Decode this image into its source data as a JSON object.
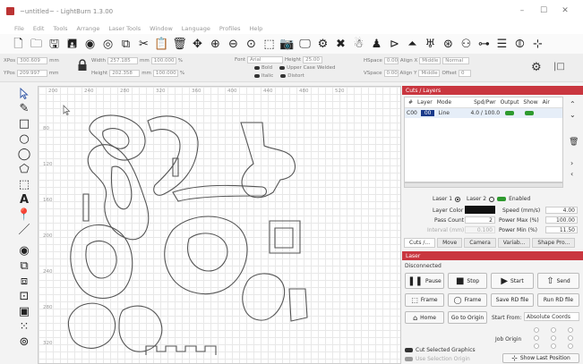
{
  "window": {
    "title": "~untitled~ - LightBurn 1.3.00",
    "min": "–",
    "max": "☐",
    "close": "✕"
  },
  "menu": [
    "File",
    "Edit",
    "Tools",
    "Arrange",
    "Laser Tools",
    "Window",
    "Language",
    "Profiles",
    "Help"
  ],
  "toolbar_icons": [
    "new-file",
    "open",
    "save",
    "save-as",
    "import",
    "export",
    "copy",
    "cut",
    "paste",
    "delete",
    "move",
    "zoom-in",
    "zoom-out",
    "zoom-frame",
    "zoom-selection",
    "camera",
    "monitor",
    "settings",
    "tools",
    "users",
    "user",
    "arrange-1",
    "arrange-2",
    "arrange-3",
    "target",
    "group",
    "ungroup",
    "align",
    "distribute",
    "center"
  ],
  "numbar": {
    "xpos_label": "XPos",
    "xpos": "300.609",
    "ypos_label": "YPos",
    "ypos": "209.997",
    "unit": "mm",
    "width_label": "Width",
    "width": "257.185",
    "height_label": "Height",
    "height": "202.358",
    "wpct": "100.000",
    "hpct": "100.000",
    "pct": "%",
    "font_label": "Font",
    "font": "Arial",
    "fheight_label": "Height",
    "fheight": "25.00",
    "bold": "Bold",
    "italic": "Italic",
    "upper": "Upper Case",
    "distort": "Distort",
    "welded": "Welded",
    "hspace_label": "HSpace",
    "hspace": "0.00",
    "vspace_label": "VSpace",
    "vspace": "0.00",
    "alignx": "Align X",
    "aligny": "Align Y",
    "middle": "Middle",
    "normal": "Normal",
    "offset_label": "Offset",
    "offset": "0"
  },
  "left_tools": [
    "select-arrow",
    "edit-nodes",
    "rectangle",
    "ellipse",
    "ellipse-2",
    "polygon",
    "frame-tool",
    "text-tool",
    "position-pin",
    "measure-tool",
    "offset-tool",
    "boolean-union",
    "boolean-subtract",
    "boolean-intersect",
    "weld-tool",
    "grid-array",
    "circular-array"
  ],
  "ruler": {
    "x": [
      "200",
      "240",
      "280",
      "320",
      "360",
      "400",
      "440",
      "480",
      "520"
    ],
    "y": [
      "80",
      "120",
      "160",
      "200",
      "240",
      "280",
      "320"
    ]
  },
  "cuts": {
    "title": "Cuts / Layers",
    "headers": [
      "#",
      "Layer",
      "Mode",
      "Spd/Pwr",
      "Output",
      "Show",
      "Air"
    ],
    "rows": [
      {
        "num": "C00",
        "layer": "00",
        "mode": "Line",
        "spd": "4.0 / 100.0"
      }
    ],
    "laser1": "Laser 1",
    "laser2": "Laser 2",
    "enabled": "Enabled",
    "layer_color_label": "Layer Color",
    "pass_count_label": "Pass Count",
    "pass_count": "2",
    "interval_label": "Interval (mm)",
    "interval": "0.100",
    "speed_label": "Speed (mm/s)",
    "speed": "4.00",
    "pmax_label": "Power Max (%)",
    "pmax": "100.00",
    "pmin_label": "Power Min (%)",
    "pmin": "11.50",
    "tabs": [
      "Cuts /...",
      "Move",
      "Camera",
      "Variab...",
      "Shape Pro..."
    ]
  },
  "laser": {
    "title": "Laser",
    "status": "Disconnected",
    "pause": "Pause",
    "stop": "Stop",
    "start": "Start",
    "send": "Send",
    "frame1": "Frame",
    "frame2": "Frame",
    "save_rd": "Save RD file",
    "run_rd": "Run RD file",
    "home": "Home",
    "goto": "Go to Origin",
    "start_from_label": "Start From:",
    "start_from": "Absolute Coords",
    "job_origin": "Job Origin",
    "cut_selected": "Cut Selected Graphics",
    "use_selection": "Use Selection Origin",
    "show_last": "Show Last Position"
  },
  "colors": {
    "accent": "#c9363f",
    "layer00": "#1a3a8a",
    "toggle": "#2e9a2e"
  }
}
